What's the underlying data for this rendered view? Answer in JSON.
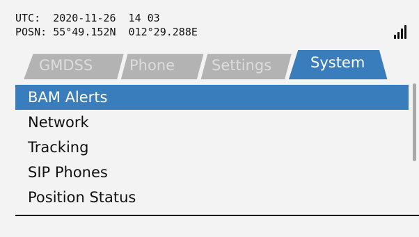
{
  "status": {
    "utc_label": "UTC:",
    "utc_value": "2020-11-26  14 03",
    "posn_label": "POSN:",
    "posn_value": "55°49.152N  012°29.288E",
    "signal_icon": "signal-strength-icon",
    "signal_bars": 4
  },
  "tabs": [
    {
      "label": "GMDSS",
      "active": false
    },
    {
      "label": "Phone",
      "active": false
    },
    {
      "label": "Settings",
      "active": false
    },
    {
      "label": "System",
      "active": true
    }
  ],
  "menu": {
    "items": [
      {
        "label": "BAM Alerts",
        "selected": true
      },
      {
        "label": "Network",
        "selected": false
      },
      {
        "label": "Tracking",
        "selected": false
      },
      {
        "label": "SIP Phones",
        "selected": false
      },
      {
        "label": "Position Status",
        "selected": false
      }
    ]
  },
  "colors": {
    "accent": "#3a7dbd",
    "inactive_tab": "#b3b3b3",
    "background": "#f3f3f3",
    "text": "#111111"
  }
}
